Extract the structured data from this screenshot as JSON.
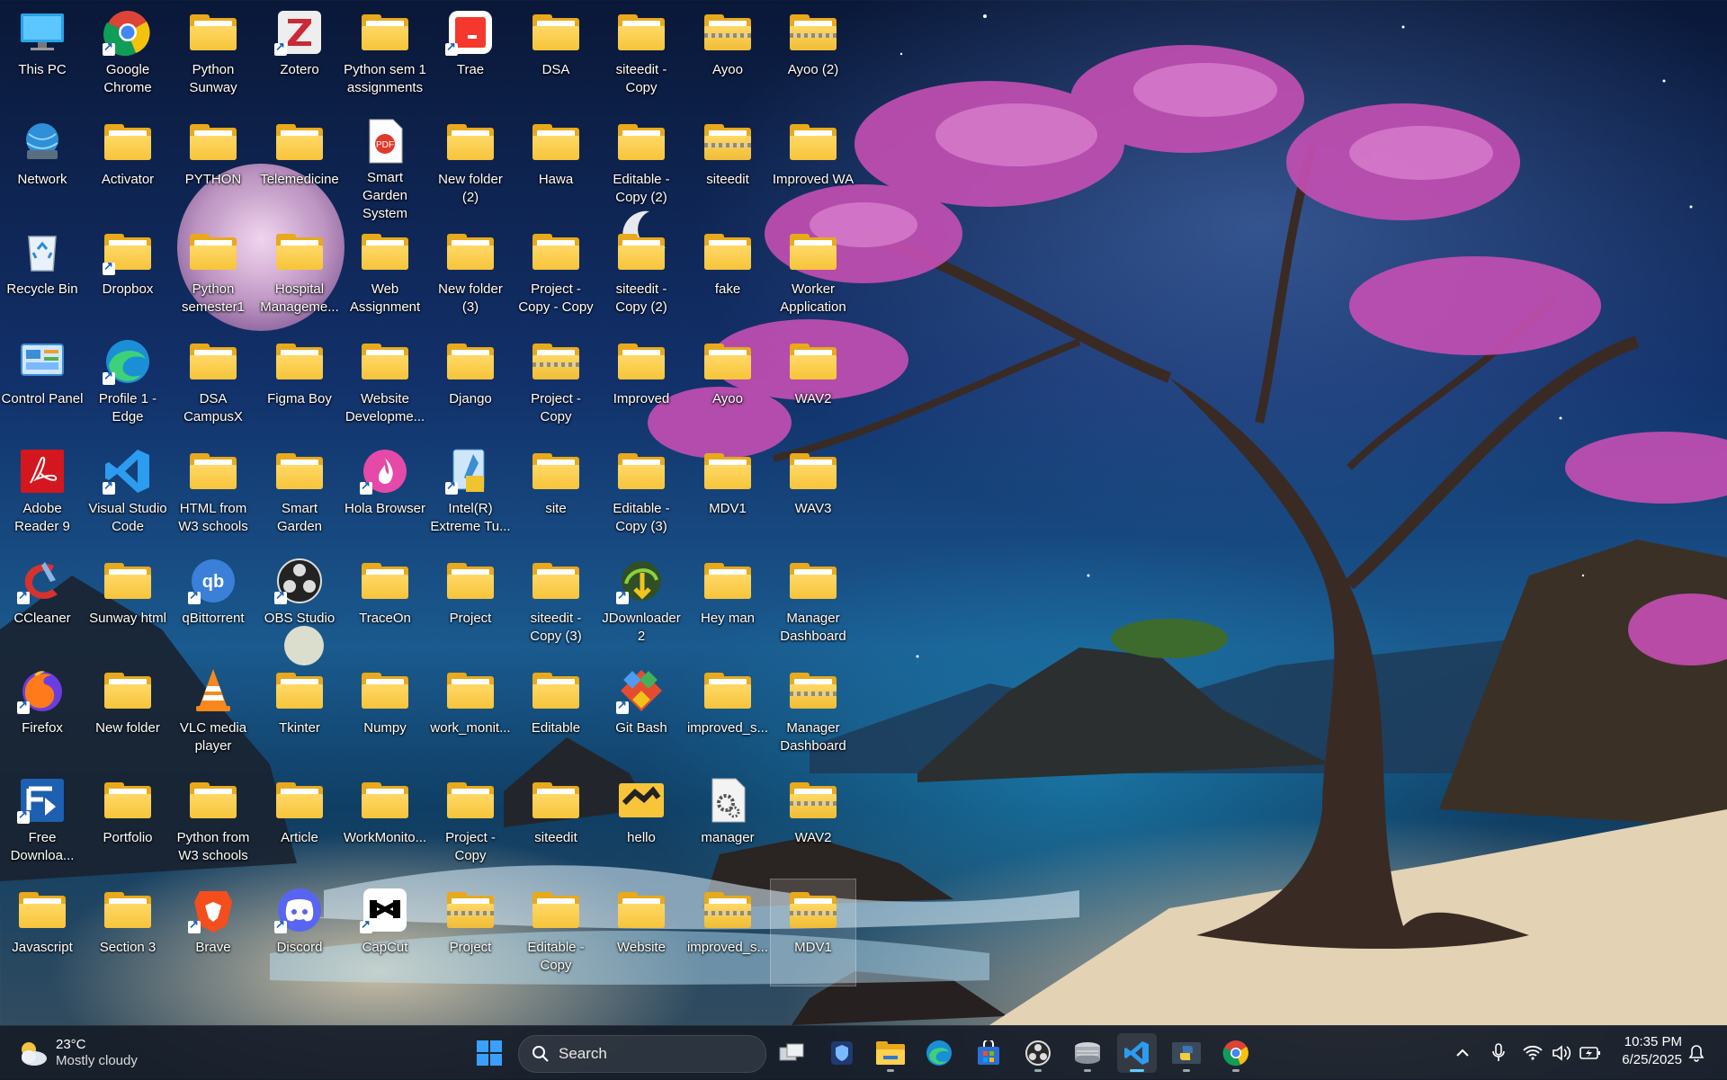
{
  "desktop": {
    "icons": [
      {
        "label": "This PC",
        "icon": "monitor-icon"
      },
      {
        "label": "Google Chrome",
        "icon": "chrome-icon"
      },
      {
        "label": "Python Sunway",
        "icon": "folder-icon"
      },
      {
        "label": "Zotero",
        "icon": "zotero-icon"
      },
      {
        "label": "Python sem 1 assignments",
        "icon": "folder-icon"
      },
      {
        "label": "Trae",
        "icon": "trae-icon"
      },
      {
        "label": "DSA",
        "icon": "folder-icon"
      },
      {
        "label": "siteedit - Copy",
        "icon": "folder-icon"
      },
      {
        "label": "Ayoo",
        "icon": "zip-folder-icon"
      },
      {
        "label": "Ayoo (2)",
        "icon": "zip-folder-icon"
      },
      {
        "label": "Network",
        "icon": "network-icon"
      },
      {
        "label": "Activator",
        "icon": "folder-icon"
      },
      {
        "label": "PYTHON",
        "icon": "folder-icon"
      },
      {
        "label": "Telemedicine",
        "icon": "folder-icon"
      },
      {
        "label": "Smart Garden System",
        "icon": "pdf-icon"
      },
      {
        "label": "New folder (2)",
        "icon": "folder-icon"
      },
      {
        "label": "Hawa",
        "icon": "folder-icon"
      },
      {
        "label": "Editable - Copy (2)",
        "icon": "folder-icon"
      },
      {
        "label": "siteedit",
        "icon": "zip-folder-icon"
      },
      {
        "label": "Improved WA",
        "icon": "folder-icon"
      },
      {
        "label": "Recycle Bin",
        "icon": "recycle-bin-icon"
      },
      {
        "label": "Dropbox",
        "icon": "folder-icon"
      },
      {
        "label": "Python semester1",
        "icon": "folder-icon"
      },
      {
        "label": "Hospital Manageme...",
        "icon": "folder-icon"
      },
      {
        "label": "Web Assignment",
        "icon": "folder-icon"
      },
      {
        "label": "New folder (3)",
        "icon": "folder-icon"
      },
      {
        "label": "Project - Copy - Copy",
        "icon": "folder-icon"
      },
      {
        "label": "siteedit - Copy (2)",
        "icon": "folder-icon"
      },
      {
        "label": "fake",
        "icon": "folder-icon"
      },
      {
        "label": "Worker Application",
        "icon": "folder-icon"
      },
      {
        "label": "Control Panel",
        "icon": "control-panel-icon"
      },
      {
        "label": "Profile 1 - Edge",
        "icon": "edge-icon"
      },
      {
        "label": "DSA CampusX",
        "icon": "folder-icon"
      },
      {
        "label": "Figma Boy",
        "icon": "folder-icon"
      },
      {
        "label": "Website Developme...",
        "icon": "folder-icon"
      },
      {
        "label": "Django",
        "icon": "folder-icon"
      },
      {
        "label": "Project - Copy",
        "icon": "zip-folder-icon"
      },
      {
        "label": "Improved",
        "icon": "folder-icon"
      },
      {
        "label": "Ayoo",
        "icon": "folder-icon"
      },
      {
        "label": "WAV2",
        "icon": "folder-icon"
      },
      {
        "label": "Adobe Reader 9",
        "icon": "adobe-reader-icon"
      },
      {
        "label": "Visual Studio Code",
        "icon": "vscode-icon"
      },
      {
        "label": "HTML from W3 schools",
        "icon": "folder-icon"
      },
      {
        "label": "Smart Garden",
        "icon": "folder-icon"
      },
      {
        "label": "Hola Browser",
        "icon": "hola-browser-icon"
      },
      {
        "label": "Intel(R) Extreme Tu...",
        "icon": "intel-xtu-icon"
      },
      {
        "label": "site",
        "icon": "folder-icon"
      },
      {
        "label": "Editable - Copy (3)",
        "icon": "folder-icon"
      },
      {
        "label": "MDV1",
        "icon": "folder-icon"
      },
      {
        "label": "WAV3",
        "icon": "folder-icon"
      },
      {
        "label": "CCleaner",
        "icon": "ccleaner-icon"
      },
      {
        "label": "Sunway html",
        "icon": "folder-icon"
      },
      {
        "label": "qBittorrent",
        "icon": "qbittorrent-icon"
      },
      {
        "label": "OBS Studio",
        "icon": "obs-icon"
      },
      {
        "label": "TraceOn",
        "icon": "folder-icon"
      },
      {
        "label": "Project",
        "icon": "folder-icon"
      },
      {
        "label": "siteedit - Copy (3)",
        "icon": "folder-icon"
      },
      {
        "label": "JDownloader 2",
        "icon": "jdownloader-icon"
      },
      {
        "label": "Hey man",
        "icon": "folder-icon"
      },
      {
        "label": "Manager Dashboard",
        "icon": "folder-icon"
      },
      {
        "label": "Firefox",
        "icon": "firefox-icon"
      },
      {
        "label": "New folder",
        "icon": "folder-icon"
      },
      {
        "label": "VLC media player",
        "icon": "vlc-icon"
      },
      {
        "label": "Tkinter",
        "icon": "folder-icon"
      },
      {
        "label": "Numpy",
        "icon": "folder-icon"
      },
      {
        "label": "work_monit...",
        "icon": "folder-icon"
      },
      {
        "label": "Editable",
        "icon": "folder-icon"
      },
      {
        "label": "Git Bash",
        "icon": "git-bash-icon"
      },
      {
        "label": "improved_s...",
        "icon": "folder-icon"
      },
      {
        "label": "Manager Dashboard",
        "icon": "zip-folder-icon"
      },
      {
        "label": "Free Downloa...",
        "icon": "free-download-manager-icon"
      },
      {
        "label": "Portfolio",
        "icon": "folder-icon"
      },
      {
        "label": "Python from W3 schools",
        "icon": "folder-icon"
      },
      {
        "label": "Article",
        "icon": "folder-icon"
      },
      {
        "label": "WorkMonito...",
        "icon": "folder-icon"
      },
      {
        "label": "Project - Copy",
        "icon": "folder-icon"
      },
      {
        "label": "siteedit",
        "icon": "folder-icon"
      },
      {
        "label": "hello",
        "icon": "hello-folder-icon"
      },
      {
        "label": "manager",
        "icon": "settings-file-icon"
      },
      {
        "label": "WAV2",
        "icon": "zip-folder-icon"
      },
      {
        "label": "Javascript",
        "icon": "folder-icon"
      },
      {
        "label": "Section 3",
        "icon": "folder-icon"
      },
      {
        "label": "Brave",
        "icon": "brave-icon"
      },
      {
        "label": "Discord",
        "icon": "discord-icon"
      },
      {
        "label": "CapCut",
        "icon": "capcut-icon"
      },
      {
        "label": "Project",
        "icon": "zip-folder-icon"
      },
      {
        "label": "Editable - Copy",
        "icon": "folder-icon"
      },
      {
        "label": "Website",
        "icon": "folder-icon"
      },
      {
        "label": "improved_s...",
        "icon": "zip-folder-icon"
      },
      {
        "label": "MDV1",
        "icon": "zip-folder-icon",
        "selected": true
      }
    ]
  },
  "taskbar": {
    "weather": {
      "temp": "23°C",
      "condition": "Mostly cloudy",
      "icon": "partly-cloudy-icon"
    },
    "search": {
      "placeholder": "Search"
    },
    "apps": [
      {
        "name": "start-button",
        "icon": "windows-logo-icon"
      },
      {
        "name": "task-view",
        "icon": "task-view-icon"
      },
      {
        "name": "terminal-app",
        "icon": "shield-app-icon"
      },
      {
        "name": "file-explorer",
        "icon": "folder-icon",
        "running": true
      },
      {
        "name": "edge-browser",
        "icon": "edge-icon"
      },
      {
        "name": "microsoft-store",
        "icon": "store-icon"
      },
      {
        "name": "obs-app",
        "icon": "obs-icon",
        "running": true
      },
      {
        "name": "disk-app",
        "icon": "disk-icon",
        "running": true
      },
      {
        "name": "vscode-app",
        "icon": "vscode-icon",
        "running": true,
        "active": true
      },
      {
        "name": "python-app",
        "icon": "python-icon",
        "running": true
      },
      {
        "name": "chrome-app",
        "icon": "chrome-icon",
        "running": true
      }
    ],
    "tray": {
      "chevron": "^",
      "time": "10:35 PM",
      "date": "6/25/2025"
    }
  },
  "colors": {
    "folder": "#f7c43a",
    "accent": "#60cdff",
    "taskbar": "#161c28"
  }
}
